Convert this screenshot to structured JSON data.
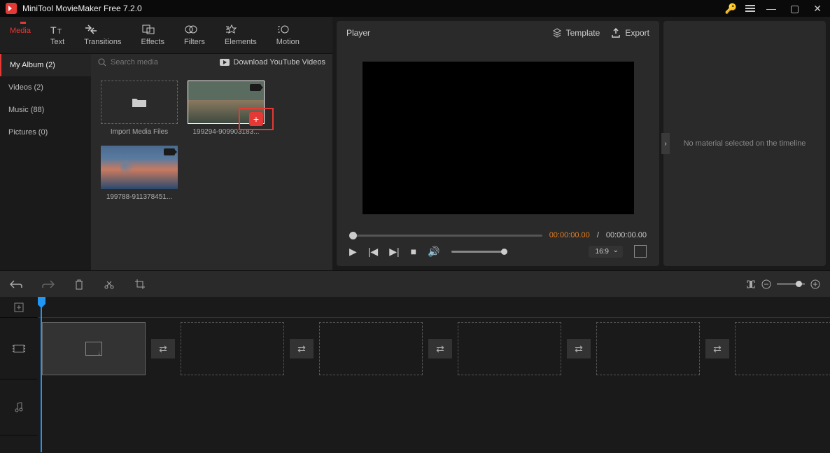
{
  "app": {
    "title": "MiniTool MovieMaker Free 7.2.0"
  },
  "mainTabs": {
    "media": "Media",
    "text": "Text",
    "transitions": "Transitions",
    "effects": "Effects",
    "filters": "Filters",
    "elements": "Elements",
    "motion": "Motion"
  },
  "library": {
    "sidebar": {
      "myAlbum": "My Album (2)",
      "videos": "Videos (2)",
      "music": "Music (88)",
      "pictures": "Pictures (0)"
    },
    "searchPlaceholder": "Search media",
    "downloadLabel": "Download YouTube Videos",
    "importLabel": "Import Media Files",
    "item1": "199294-909903183...",
    "item2": "199788-911378451..."
  },
  "player": {
    "title": "Player",
    "templateLabel": "Template",
    "exportLabel": "Export",
    "currentTime": "00:00:00.00",
    "separator": "/",
    "totalTime": "00:00:00.00",
    "aspect": "16:9"
  },
  "properties": {
    "empty": "No material selected on the timeline"
  }
}
